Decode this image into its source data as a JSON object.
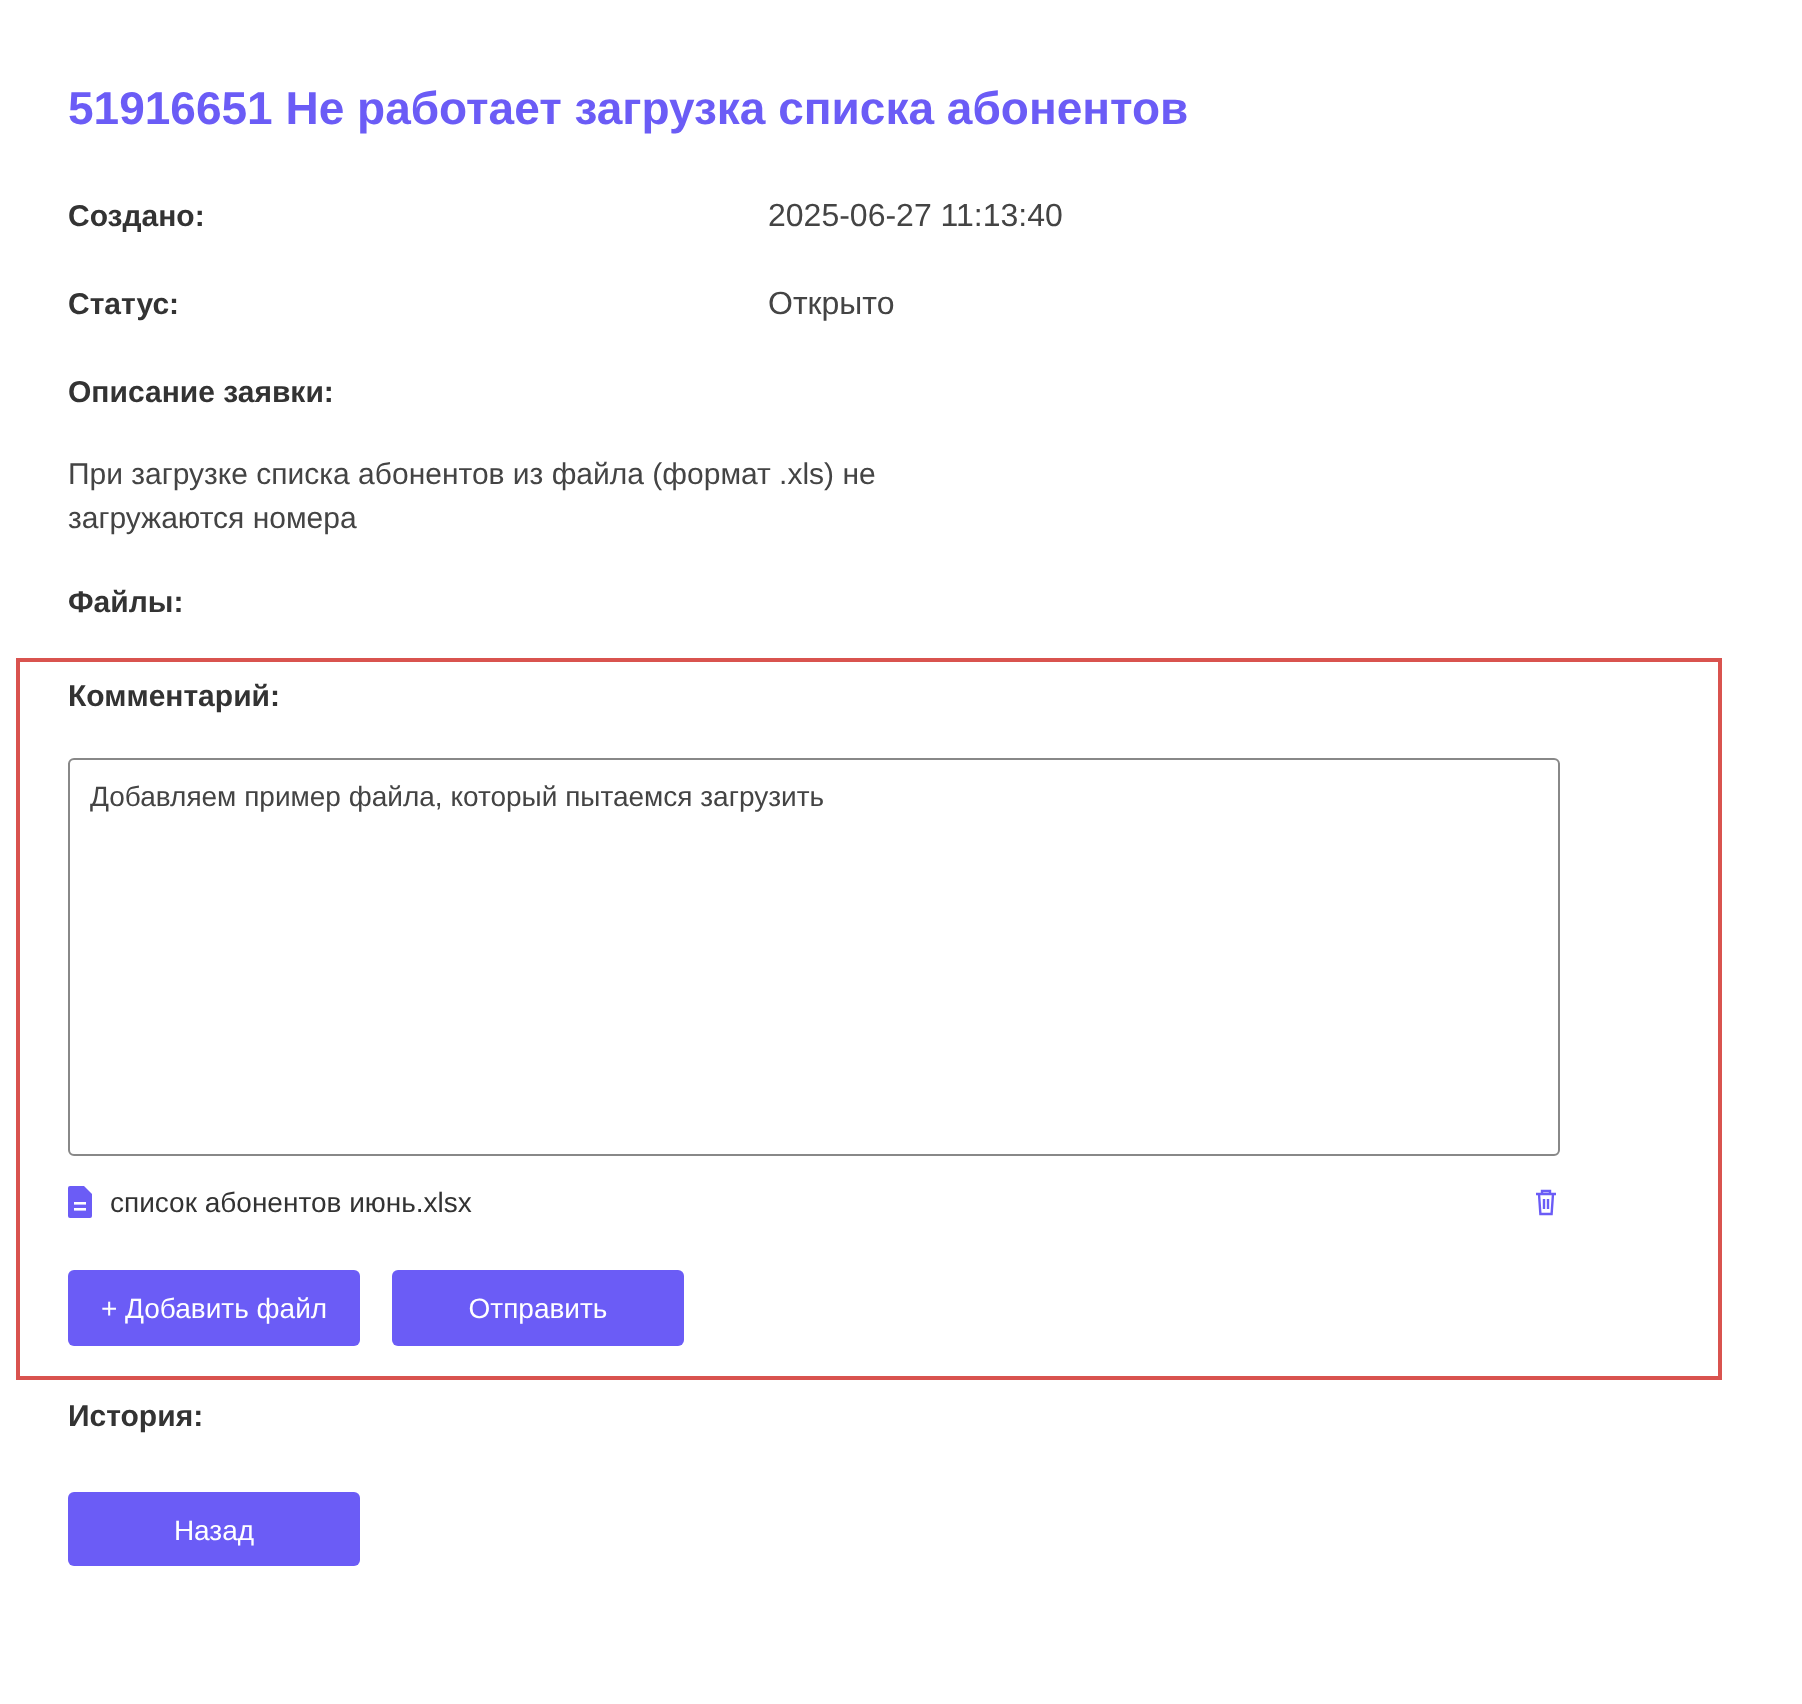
{
  "title": "51916651 Не работает загрузка списка абонентов",
  "fields": [
    {
      "label": "Создано:",
      "value": "2025-06-27 11:13:40"
    },
    {
      "label": "Статус:",
      "value": "Открыто"
    }
  ],
  "description": {
    "label": "Описание заявки:",
    "text": "При загрузке списка абонентов из файла (формат .xls) не загружаются номера"
  },
  "files": {
    "label": "Файлы:"
  },
  "comment": {
    "label": "Комментарий:",
    "value": "Добавляем пример файла, который пытаемся загрузить",
    "attachments": [
      {
        "name": "список абонентов июнь.xlsx"
      }
    ],
    "buttons": [
      "+ Добавить файл",
      "Отправить"
    ]
  },
  "history": {
    "label": "История:"
  },
  "back_button": "Назад"
}
